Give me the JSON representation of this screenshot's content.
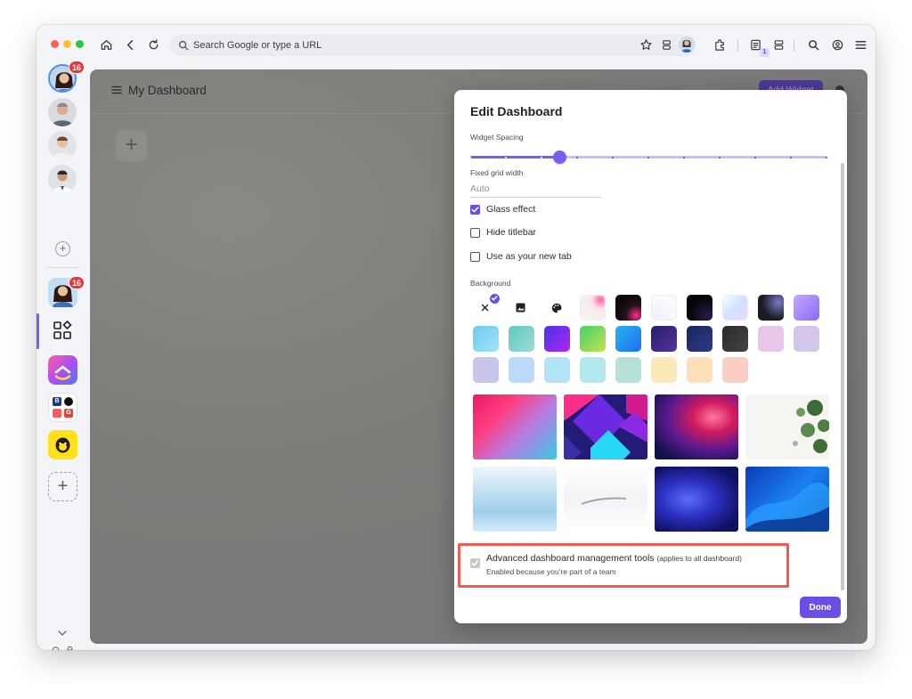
{
  "browser": {
    "address_placeholder": "Search Google or type a URL",
    "reading_list_count": "1"
  },
  "sidebar": {
    "profile_badge": "16",
    "app_badge": "16",
    "booking_letters": [
      "B",
      "G"
    ]
  },
  "dashboard": {
    "title": "My Dashboard",
    "add_widget_label": "Add Widget"
  },
  "modal": {
    "title": "Edit Dashboard",
    "widget_spacing_label": "Widget Spacing",
    "widget_spacing_value_fraction": 0.25,
    "fixed_grid_label": "Fixed grid width",
    "fixed_grid_placeholder": "Auto",
    "options": [
      {
        "label": "Glass effect",
        "checked": true
      },
      {
        "label": "Hide titlebar",
        "checked": false
      },
      {
        "label": "Use as your new tab",
        "checked": false
      }
    ],
    "background_label": "Background",
    "advanced": {
      "title": "Advanced dashboard management tools",
      "scope": "(applies to all dashboard)",
      "subtitle": "Enabled because you're part of a team",
      "checked": true,
      "disabled": true
    },
    "done_label": "Done"
  },
  "colors": {
    "accent": "#6a4ee6",
    "highlight": "#ef5b53",
    "notification": "#e5383b"
  },
  "icons": [
    "home-icon",
    "back-icon",
    "reload-icon",
    "search-icon",
    "star-icon",
    "tabs-icon",
    "extensions-icon",
    "reading-list-icon",
    "layers-icon",
    "account-icon",
    "menu-icon",
    "image-icon",
    "palette-icon",
    "close-icon",
    "bell-icon",
    "lock-icon",
    "compass-icon",
    "gear-icon"
  ]
}
